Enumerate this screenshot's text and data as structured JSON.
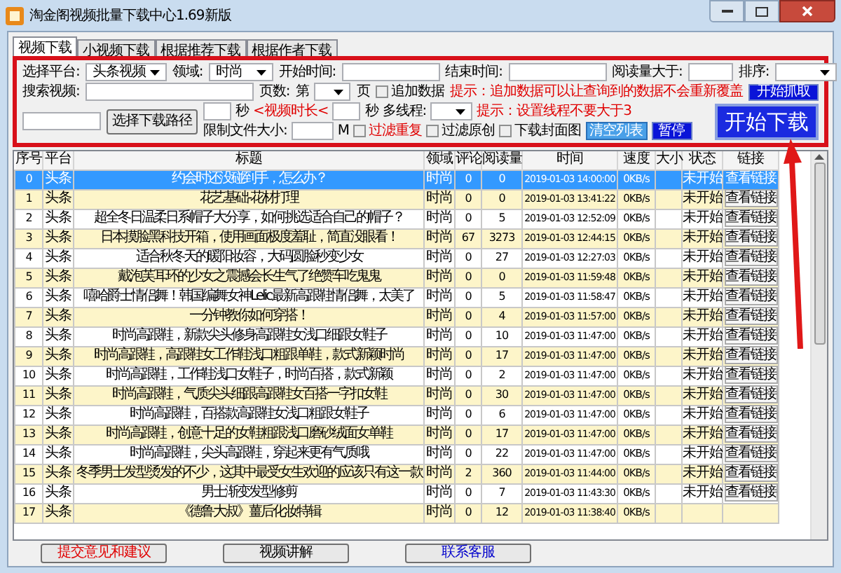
{
  "window": {
    "title": "淘金阁视频批量下载中心1.69新版"
  },
  "tabs": [
    {
      "label": "视频下载",
      "selected": true
    },
    {
      "label": "小视频下载",
      "selected": false
    },
    {
      "label": "根据推荐下载",
      "selected": false
    },
    {
      "label": "根据作者下载",
      "selected": false
    }
  ],
  "filters": {
    "platform": {
      "label": "选择平台:",
      "value": "头条视频"
    },
    "field": {
      "label": "领域:",
      "value": "时尚"
    },
    "start_time": {
      "label": "开始时间:"
    },
    "end_time": {
      "label": "结束时间:"
    },
    "reads_min": {
      "label": "阅读量大于:"
    },
    "sort": {
      "label": "排序:"
    },
    "search": {
      "label": "搜索视频:"
    },
    "pages": {
      "label": "页数:",
      "prefix": "第",
      "suffix": "页"
    },
    "append": {
      "label": "追加数据",
      "checked": false
    },
    "append_hint": "提示：追加数据可以让查询到的数据不会重新覆盖",
    "fetch_button": "开始抓取",
    "path_button": "选择下载路径",
    "duration": {
      "unit_1": "秒",
      "label": "<视频时长<",
      "unit_2": "秒"
    },
    "threads": {
      "label": "多线程:"
    },
    "threads_hint": "提示：设置线程不要大于3",
    "size_limit": {
      "label": "限制文件大小:",
      "unit": "M"
    },
    "options": [
      {
        "label": "过滤重复",
        "checked": false,
        "color": "#e00000"
      },
      {
        "label": "过滤原创",
        "checked": false,
        "color": "#000000"
      },
      {
        "label": "下载封面图",
        "checked": false,
        "color": "#000000"
      }
    ],
    "clear_button": "清空列表",
    "pause_button": "暂停",
    "start_button": "开始下载"
  },
  "table": {
    "columns": [
      "序号",
      "平台",
      "标题",
      "领域",
      "评论",
      "阅读量",
      "时间",
      "速度",
      "大小",
      "状态",
      "链接"
    ],
    "rows": [
      {
        "no": "0",
        "platform": "头条",
        "title": "约会时还没碰到手，怎么办？",
        "field": "时尚",
        "comments": "0",
        "reads": "0",
        "time": "2019-01-03 14:00:00",
        "speed": "0KB/s",
        "status": "未开始",
        "link": "查看链接",
        "selected": true
      },
      {
        "no": "1",
        "platform": "头条",
        "title": "花艺基础-花材打理",
        "field": "时尚",
        "comments": "0",
        "reads": "0",
        "time": "2019-01-03 13:41:22",
        "speed": "0KB/s",
        "status": "未开始",
        "link": "查看链接",
        "selected": false
      },
      {
        "no": "2",
        "platform": "头条",
        "title": "超全冬日温柔日系帽子大分享，如何挑选适合自己的帽子？",
        "field": "时尚",
        "comments": "0",
        "reads": "5",
        "time": "2019-01-03 12:52:09",
        "speed": "0KB/s",
        "status": "未开始",
        "link": "查看链接",
        "selected": false
      },
      {
        "no": "3",
        "platform": "头条",
        "title": "日本摸脸黑科技开箱，使用画面极度羞耻，简直没眼看！",
        "field": "时尚",
        "comments": "67",
        "reads": "3273",
        "time": "2019-01-03 12:44:15",
        "speed": "0KB/s",
        "status": "未开始",
        "link": "查看链接",
        "selected": false
      },
      {
        "no": "4",
        "platform": "头条",
        "title": "适合秋冬天的暖阳妆容，大码圆脸秒变少女",
        "field": "时尚",
        "comments": "0",
        "reads": "27",
        "time": "2019-01-03 12:27:03",
        "speed": "0KB/s",
        "status": "未开始",
        "link": "查看链接",
        "selected": false
      },
      {
        "no": "5",
        "platform": "头条",
        "title": "戴泡芙耳环的少女之震撼会长生气了绝赞车吃鬼鬼",
        "field": "时尚",
        "comments": "0",
        "reads": "0",
        "time": "2019-01-03 11:59:48",
        "speed": "0KB/s",
        "status": "未开始",
        "link": "查看链接",
        "selected": false
      },
      {
        "no": "6",
        "platform": "头条",
        "title": "嘻哈爵士情侣舞！韩国编舞女神Lelic最新高跟鞋情侣舞，太美了",
        "field": "时尚",
        "comments": "0",
        "reads": "5",
        "time": "2019-01-03 11:58:47",
        "speed": "0KB/s",
        "status": "未开始",
        "link": "查看链接",
        "selected": false
      },
      {
        "no": "7",
        "platform": "头条",
        "title": "一分钟教你如何穿搭！",
        "field": "时尚",
        "comments": "0",
        "reads": "4",
        "time": "2019-01-03 11:57:00",
        "speed": "0KB/s",
        "status": "未开始",
        "link": "查看链接",
        "selected": false
      },
      {
        "no": "8",
        "platform": "头条",
        "title": "时尚高跟鞋，新款尖头修身高跟鞋女浅口细跟女鞋子",
        "field": "时尚",
        "comments": "0",
        "reads": "10",
        "time": "2019-01-03 11:47:00",
        "speed": "0KB/s",
        "status": "未开始",
        "link": "查看链接",
        "selected": false
      },
      {
        "no": "9",
        "platform": "头条",
        "title": "时尚高跟鞋，高跟鞋女工作鞋浅口粗跟单鞋，款式新颖时尚",
        "field": "时尚",
        "comments": "0",
        "reads": "17",
        "time": "2019-01-03 11:47:00",
        "speed": "0KB/s",
        "status": "未开始",
        "link": "查看链接",
        "selected": false
      },
      {
        "no": "10",
        "platform": "头条",
        "title": "时尚高跟鞋，工作鞋浅口女鞋子，时尚百搭，款式新颖",
        "field": "时尚",
        "comments": "0",
        "reads": "2",
        "time": "2019-01-03 11:47:00",
        "speed": "0KB/s",
        "status": "未开始",
        "link": "查看链接",
        "selected": false
      },
      {
        "no": "11",
        "platform": "头条",
        "title": "时尚高跟鞋，气质尖头细跟高跟鞋女百搭一字扣女鞋",
        "field": "时尚",
        "comments": "0",
        "reads": "30",
        "time": "2019-01-03 11:47:00",
        "speed": "0KB/s",
        "status": "未开始",
        "link": "查看链接",
        "selected": false
      },
      {
        "no": "12",
        "platform": "头条",
        "title": "时尚高跟鞋，百搭款高跟鞋女浅口粗跟女鞋子",
        "field": "时尚",
        "comments": "0",
        "reads": "6",
        "time": "2019-01-03 11:47:00",
        "speed": "0KB/s",
        "status": "未开始",
        "link": "查看链接",
        "selected": false
      },
      {
        "no": "13",
        "platform": "头条",
        "title": "时尚高跟鞋，创意十足的女鞋粗跟浅口磨砂绒面女单鞋",
        "field": "时尚",
        "comments": "0",
        "reads": "17",
        "time": "2019-01-03 11:47:00",
        "speed": "0KB/s",
        "status": "未开始",
        "link": "查看链接",
        "selected": false
      },
      {
        "no": "14",
        "platform": "头条",
        "title": "时尚高跟鞋，尖头高跟鞋，穿起来更有气质哦",
        "field": "时尚",
        "comments": "0",
        "reads": "22",
        "time": "2019-01-03 11:47:00",
        "speed": "0KB/s",
        "status": "未开始",
        "link": "查看链接",
        "selected": false
      },
      {
        "no": "15",
        "platform": "头条",
        "title": "冬季男士发型烫发的不少，这其中最受女生欢迎的应该只有这一款",
        "field": "时尚",
        "comments": "2",
        "reads": "360",
        "time": "2019-01-03 11:44:00",
        "speed": "0KB/s",
        "status": "未开始",
        "link": "查看链接",
        "selected": false
      },
      {
        "no": "16",
        "platform": "头条",
        "title": "男士渐变发型修剪",
        "field": "时尚",
        "comments": "0",
        "reads": "7",
        "time": "2019-01-03 11:43:30",
        "speed": "0KB/s",
        "status": "未开始",
        "link": "查看链接",
        "selected": false
      },
      {
        "no": "17",
        "platform": "头条",
        "title": "《德鲁大叔》薑后化妆特辑",
        "field": "时尚",
        "comments": "0",
        "reads": "12",
        "time": "2019-01-03 11:38:40",
        "speed": "0KB/s",
        "selected": false
      }
    ]
  },
  "bottom_buttons": [
    {
      "label": "提交意见和建议",
      "color": "#e00000"
    },
    {
      "label": "视频讲解",
      "color": "#000000"
    },
    {
      "label": "联系客服",
      "color": "#0000cc"
    }
  ]
}
